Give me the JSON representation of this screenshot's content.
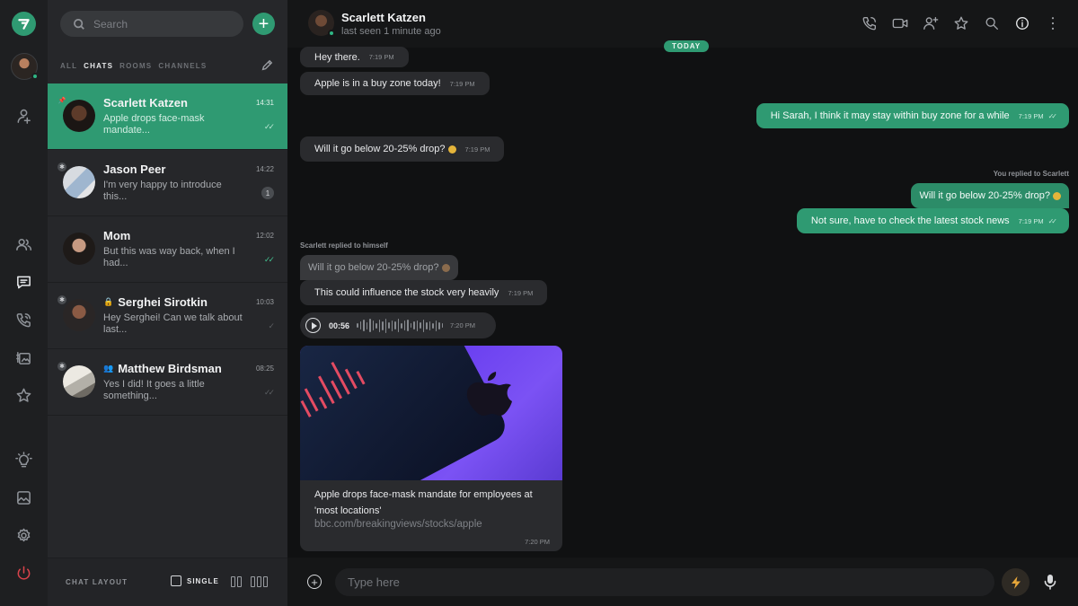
{
  "rail": {
    "items": [
      "logo",
      "add-contact",
      "contacts",
      "chats",
      "calls",
      "stories",
      "favorites",
      "ideas",
      "gallery",
      "settings",
      "power"
    ]
  },
  "list": {
    "search_placeholder": "Search",
    "filters": [
      "ALL",
      "CHATS",
      "ROOMS",
      "CHANNELS"
    ],
    "active_filter": "CHATS",
    "chats": [
      {
        "name": "Scarlett Katzen",
        "preview": "Apple drops face-mask mandate...",
        "time": "14:31",
        "selected": true
      },
      {
        "name": "Jason Peer",
        "preview": "I'm very happy to introduce this...",
        "time": "14:22",
        "badge": "1"
      },
      {
        "name": "Mom",
        "preview": "But this was way back, when I had...",
        "time": "12:02"
      },
      {
        "name": "Serghei Sirotkin",
        "preview": "Hey Serghei! Can we talk about last...",
        "time": "10:03"
      },
      {
        "name": "Matthew Birdsman",
        "preview": "Yes I did! It goes a little something...",
        "time": "08:25"
      }
    ],
    "footer": {
      "label": "CHAT LAYOUT",
      "single": "SINGLE"
    }
  },
  "conversation": {
    "name": "Scarlett Katzen",
    "status": "last seen 1 minute ago",
    "date_badge": "TODAY",
    "messages": {
      "m1": {
        "text": "Hey there.",
        "time": "7:19 PM"
      },
      "m2": {
        "text": "Apple is in a buy zone today!",
        "time": "7:19 PM"
      },
      "m3": {
        "text": "Hi Sarah, I think it may stay within buy zone for a while",
        "time": "7:19 PM"
      },
      "m4": {
        "text": "Will it go below 20-25% drop?",
        "time": "7:19 PM"
      },
      "reply_note_out": "You replied to Scarlett",
      "m5_quote": "Will it go below 20-25% drop?",
      "m5": {
        "text": "Not sure, have to check the latest stock news",
        "time": "7:19 PM"
      },
      "reply_note_in": "Scarlett replied to himself",
      "m6_quote": "Will it go below 20-25% drop?",
      "m6": {
        "text": "This could influence the stock very heavily",
        "time": "7:19 PM"
      },
      "voice": {
        "duration": "00:56",
        "time": "7:20 PM"
      },
      "link": {
        "title": "Apple drops face-mask mandate for employees at 'most locations'",
        "url": "bbc.com/breakingviews/stocks/apple",
        "time": "7:20 PM"
      }
    },
    "composer_placeholder": "Type here"
  },
  "colors": {
    "accent": "#2f9a72",
    "danger": "#d9434b",
    "background": "#101112"
  }
}
